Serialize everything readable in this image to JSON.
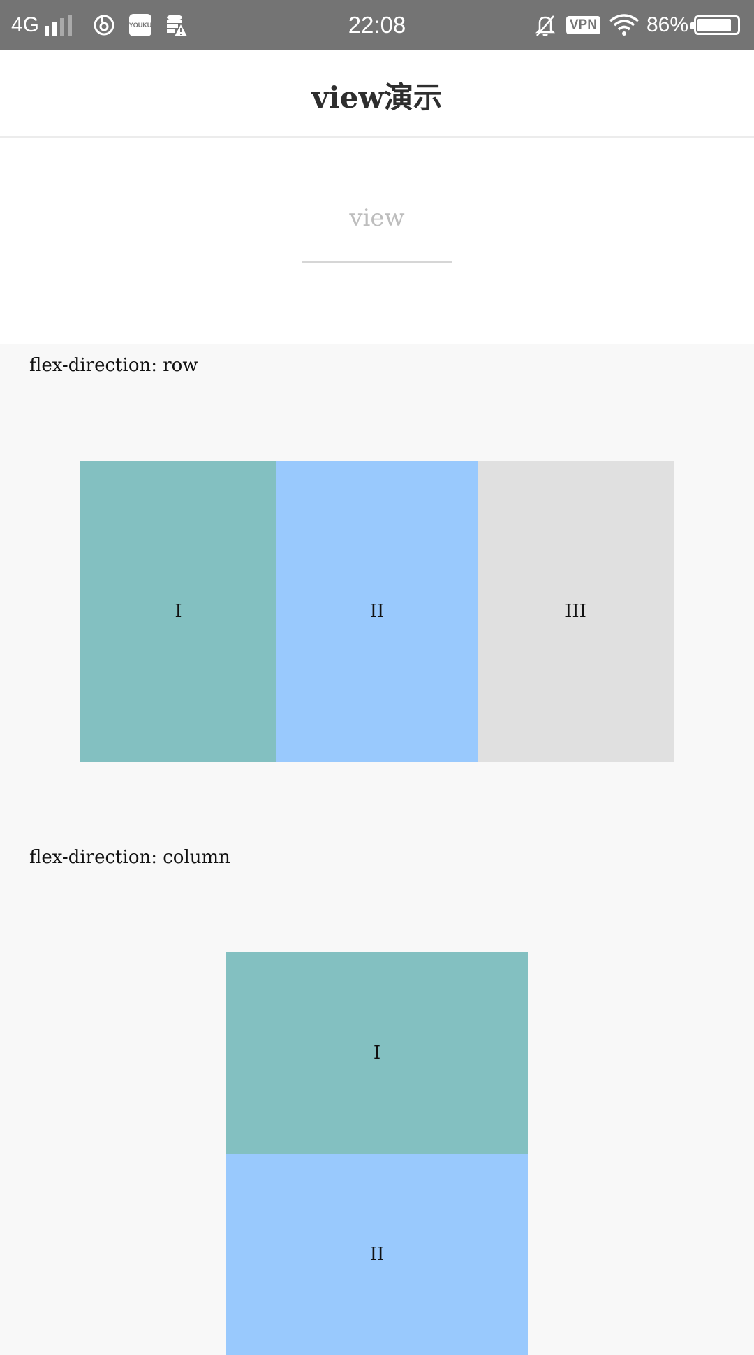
{
  "status_bar": {
    "network": "4G",
    "time": "22:08",
    "vpn": "VPN",
    "battery": "86%",
    "battery_level": 0.86,
    "icons": [
      "signal-icon",
      "netease-music-icon",
      "youku-icon",
      "storage-warning-icon",
      "mute-bell-icon",
      "wifi-icon",
      "battery-icon"
    ],
    "youku_label": "YOUKU"
  },
  "nav": {
    "title": "view演示"
  },
  "hero": {
    "label": "view"
  },
  "sections": [
    {
      "title": "flex-direction: row",
      "items": [
        {
          "label": "I",
          "color": "#83c0c1"
        },
        {
          "label": "II",
          "color": "#99c9fd"
        },
        {
          "label": "III",
          "color": "#e0e0e0"
        }
      ]
    },
    {
      "title": "flex-direction: column",
      "items": [
        {
          "label": "I",
          "color": "#83c0c1"
        },
        {
          "label": "II",
          "color": "#99c9fd"
        }
      ]
    }
  ],
  "colors": {
    "status_bar": "#747474",
    "page_bg": "#f8f8f8",
    "teal": "#83c0c1",
    "blue": "#99c9fd",
    "gray": "#e0e0e0"
  }
}
